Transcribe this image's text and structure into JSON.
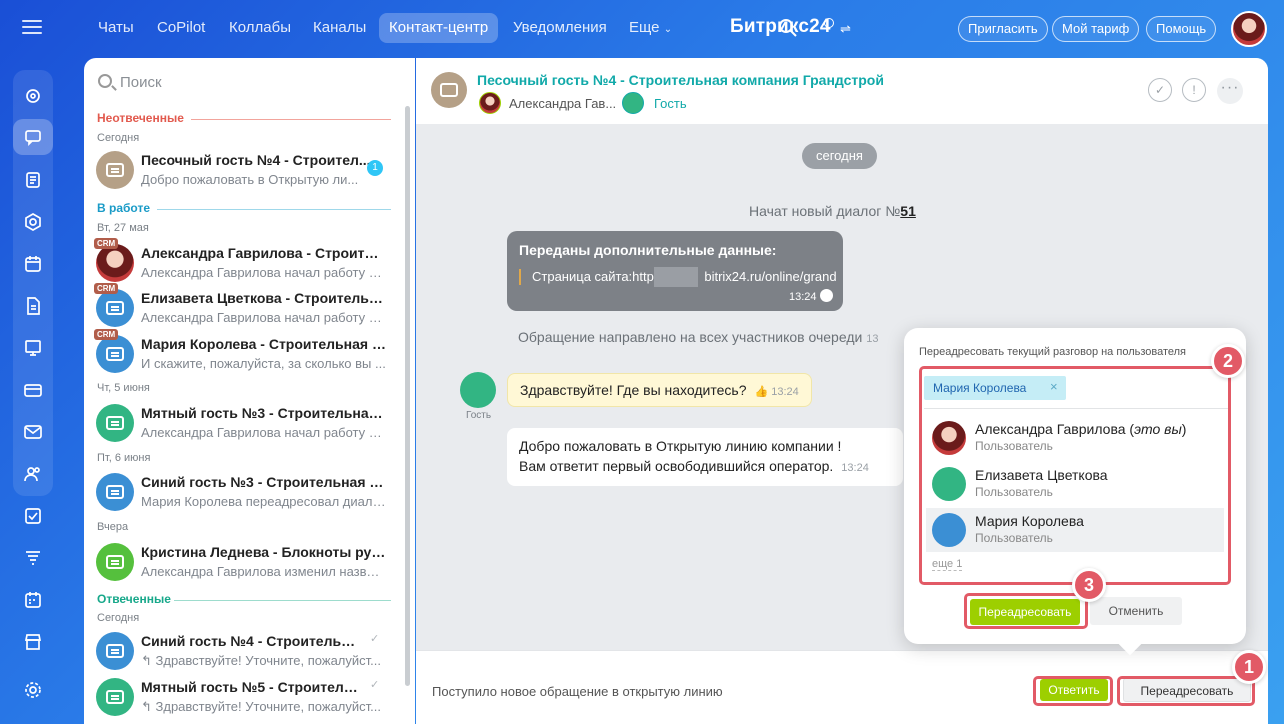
{
  "topnav": {
    "items": [
      "Чаты",
      "CoPilot",
      "Коллабы",
      "Каналы",
      "Контакт-центр",
      "Уведомления",
      "Еще"
    ],
    "brand": "Битрикс",
    "brand_num": "24",
    "invite": "Пригласить",
    "plan": "Мой тариф",
    "help": "Помощь"
  },
  "search": {
    "placeholder": "Поиск"
  },
  "sections": {
    "unanswered": "Неотвеченные",
    "in_work": "В работе",
    "answered": "Отвеченные"
  },
  "days": {
    "today": "Сегодня",
    "tue": "Вт, 27 мая",
    "thu": "Чт, 5 июня",
    "fri": "Пт, 6 июня",
    "yesterday": "Вчера",
    "today2": "Сегодня"
  },
  "chats": [
    {
      "title": "Песочный гость №4 - Строител...",
      "sub": "Добро пожаловать в Открытую ли...",
      "unread": "1"
    },
    {
      "title": "Александра Гаврилова - Строител...",
      "sub": "Александра Гаврилова начал работу с ...",
      "badge": "CRM"
    },
    {
      "title": "Елизавета Цветкова - Строительн...",
      "sub": "Александра Гаврилова начал работу с ...",
      "badge": "CRM"
    },
    {
      "title": "Мария Королева - Строительная к...",
      "sub": "И скажите, пожалуйста, за сколько вы ...",
      "badge": "CRM"
    },
    {
      "title": "Мятный гость №3 - Строительная ...",
      "sub": "Александра Гаврилова начал работу с ..."
    },
    {
      "title": "Синий гость №3 - Строительная к...",
      "sub": "Мария Королева переадресовал диало..."
    },
    {
      "title": "Кристина Леднева - Блокноты руч...",
      "sub": "Александра Гаврилова изменил назван..."
    },
    {
      "title": "Синий гость №4 - Строительна...",
      "sub": "↰ Здравствуйте! Уточните, пожалуйст..."
    },
    {
      "title": "Мятный гость №5 - Строитель...",
      "sub": "↰ Здравствуйте! Уточните, пожалуйст..."
    }
  ],
  "header": {
    "title": "Песочный гость №4 - Строительная компания Грандстрой",
    "operator": "Александра Гав...",
    "guest": "Гость"
  },
  "dialog": {
    "date": "сегодня",
    "new_dialog_prefix": "Начат новый диалог №",
    "new_dialog_num": "51",
    "extra_title": "Переданы дополнительные данные:",
    "extra_url_a": "Страница сайта:https",
    "extra_url_b": "bitrix24.ru/online/grand",
    "extra_time": "13:24",
    "queue_text": "Обращение направлено на всех участников очереди",
    "queue_time": "13",
    "guest_label": "Гость",
    "msg1": "Здравствуйте! Где вы находитесь?",
    "msg1_time": "13:24",
    "msg2_line1": "Добро пожаловать в Открытую линию компании !",
    "msg2_line2": "Вам ответит первый освободившийся оператор.",
    "msg2_time": "13:24"
  },
  "footer": {
    "text": "Поступило новое обращение в открытую линию",
    "answer": "Ответить",
    "forward": "Переадресовать"
  },
  "popup": {
    "title": "Переадресовать текущий разговор на пользователя",
    "tag": "Мария Королева",
    "users": [
      {
        "name": "Александра Гаврилова",
        "note": "это вы",
        "role": "Пользователь"
      },
      {
        "name": "Елизавета Цветкова",
        "role": "Пользователь"
      },
      {
        "name": "Мария Королева",
        "role": "Пользователь"
      }
    ],
    "more": "еще 1",
    "forward": "Переадресовать",
    "cancel": "Отменить"
  },
  "annotations": [
    "1",
    "2",
    "3"
  ],
  "colors": {
    "accent_teal": "#11a9a9",
    "green_button": "#9dcf00",
    "annotation_red": "#e25a66"
  }
}
